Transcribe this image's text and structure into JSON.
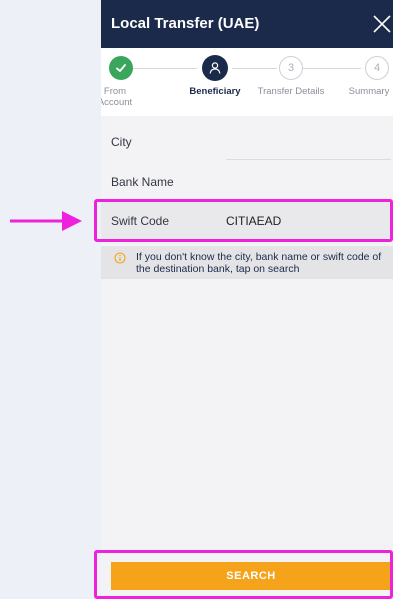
{
  "header": {
    "title": "Local Transfer (UAE)"
  },
  "stepper": {
    "steps": [
      {
        "label": "From Account",
        "number": "",
        "state": "done"
      },
      {
        "label": "Beneficiary",
        "number": "",
        "state": "active"
      },
      {
        "label": "Transfer Details",
        "number": "3",
        "state": "pending"
      },
      {
        "label": "Summary",
        "number": "4",
        "state": "pending"
      }
    ]
  },
  "form": {
    "city_label": "City",
    "city_value": "",
    "bank_name_label": "Bank Name",
    "bank_name_value": "",
    "swift_label": "Swift Code",
    "swift_value": "CITIAEAD"
  },
  "info": {
    "text": "If you don't know the city, bank name or swift code of the destination bank, tap on search"
  },
  "actions": {
    "search_label": "SEARCH"
  },
  "colors": {
    "header_bg": "#1b2a4a",
    "accent_orange": "#f5a31a",
    "success_green": "#3aa65b",
    "annotation_magenta": "#ee22dd"
  },
  "icons": {
    "close": "close-icon",
    "done": "checkmark-icon",
    "active_step": "user-icon",
    "info": "info-icon",
    "annotation": "arrow-right-icon"
  }
}
